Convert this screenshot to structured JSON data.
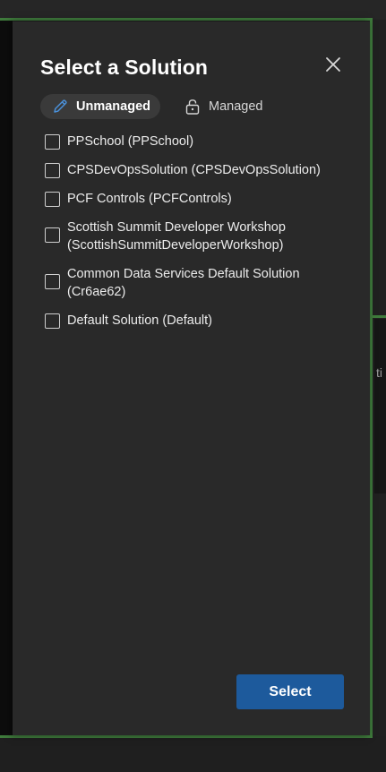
{
  "dialog": {
    "title": "Select a Solution",
    "close_icon": "close-icon"
  },
  "tabs": [
    {
      "label": "Unmanaged",
      "icon": "pencil-icon",
      "active": true
    },
    {
      "label": "Managed",
      "icon": "lock-icon",
      "active": false
    }
  ],
  "solutions": [
    {
      "label": "PPSchool (PPSchool)",
      "checked": false
    },
    {
      "label": "CPSDevOpsSolution (CPSDevOpsSolution)",
      "checked": false
    },
    {
      "label": "PCF Controls (PCFControls)",
      "checked": false
    },
    {
      "label": "Scottish Summit Developer Workshop (ScottishSummitDeveloperWorkshop)",
      "checked": false
    },
    {
      "label": "Common Data Services Default Solution (Cr6ae62)",
      "checked": false
    },
    {
      "label": "Default Solution (Default)",
      "checked": false
    }
  ],
  "footer": {
    "select_label": "Select"
  },
  "background": {
    "peek_text": "ti"
  },
  "colors": {
    "panel_bg": "#292929",
    "accent": "#1d5a9c",
    "focus_frame": "#3f7b3c",
    "pencil_icon": "#4a90d9"
  }
}
